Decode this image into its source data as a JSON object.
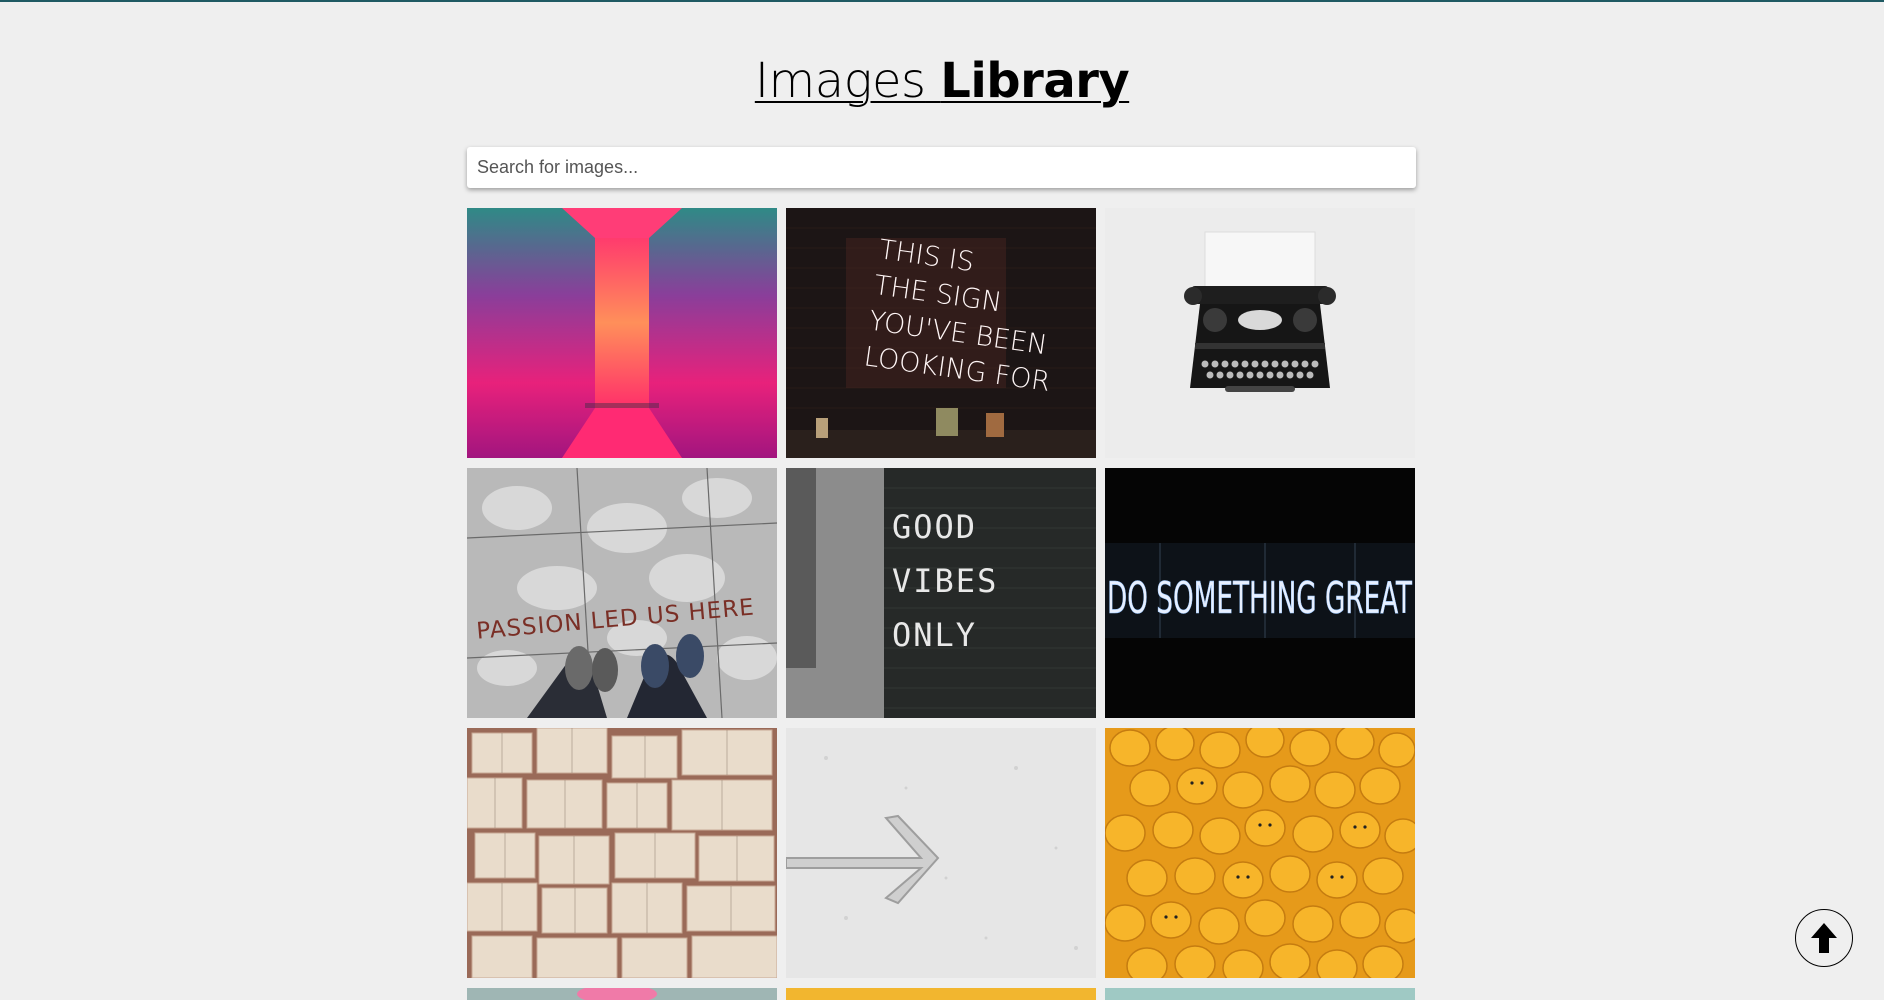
{
  "header": {
    "title_regular": "Images",
    "title_bold": "Library"
  },
  "search": {
    "placeholder": "Search for images..."
  },
  "images": [
    {
      "name": "neon-hallway-image"
    },
    {
      "name": "neon-sign-image",
      "text": [
        "THIS IS",
        "THE SIGN",
        "YOU'VE BEEN",
        "LOOKING FOR"
      ]
    },
    {
      "name": "typewriter-image"
    },
    {
      "name": "passion-floor-image",
      "text": "PASSION LED US HERE"
    },
    {
      "name": "good-vibes-board-image",
      "text": [
        "GOOD",
        "VIBES",
        "ONLY"
      ]
    },
    {
      "name": "do-something-great-image",
      "text": "DO SOMETHING GREAT"
    },
    {
      "name": "open-books-image"
    },
    {
      "name": "arrow-wall-image"
    },
    {
      "name": "lego-heads-image"
    }
  ],
  "scroll_top": {
    "icon": "arrow-up-icon"
  }
}
